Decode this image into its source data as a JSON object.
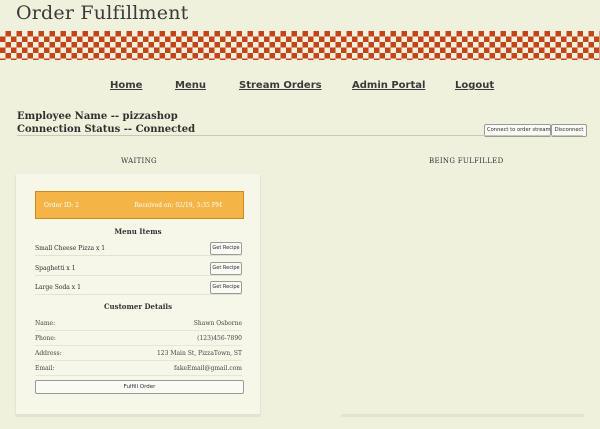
{
  "app": {
    "title": "Order Fulfillment"
  },
  "nav": {
    "home": "Home",
    "menu": "Menu",
    "stream_orders": "Stream Orders",
    "admin_portal": "Admin Portal",
    "logout": "Logout"
  },
  "session": {
    "employee": "Employee Name -- pizzashop",
    "connection": "Connection Status -- Connected",
    "connect_button": "Connect to order stream",
    "disconnect_button": "Disconnect"
  },
  "columns": {
    "waiting": "WAITING",
    "fulfilling": "BEING FULFILLED"
  },
  "order": {
    "id_text": "Order ID: 2",
    "received_text": "Received on: 02/19, 3:35 PM",
    "menu_items_title": "Menu Items",
    "items": [
      {
        "name": "Small Cheese Pizza x 1",
        "button": "Get Recipe"
      },
      {
        "name": "Spaghetti x 1",
        "button": "Get Recipe"
      },
      {
        "name": "Large Soda x 1",
        "button": "Get Recipe"
      }
    ],
    "customer_title": "Customer Details",
    "details": [
      {
        "label": "Name:",
        "value": "Shawn Osborne"
      },
      {
        "label": "Phone:",
        "value": "(123)456-7890"
      },
      {
        "label": "Address:",
        "value": "123 Main St, PizzaTown, ST"
      },
      {
        "label": "Email:",
        "value": "fakeEmail@gmail.com"
      }
    ],
    "fulfill_button": "Fulfill Order"
  },
  "colors": {
    "accent": "#c4441a",
    "order_bar": "#f3b546",
    "background": "#f0f1dc"
  }
}
